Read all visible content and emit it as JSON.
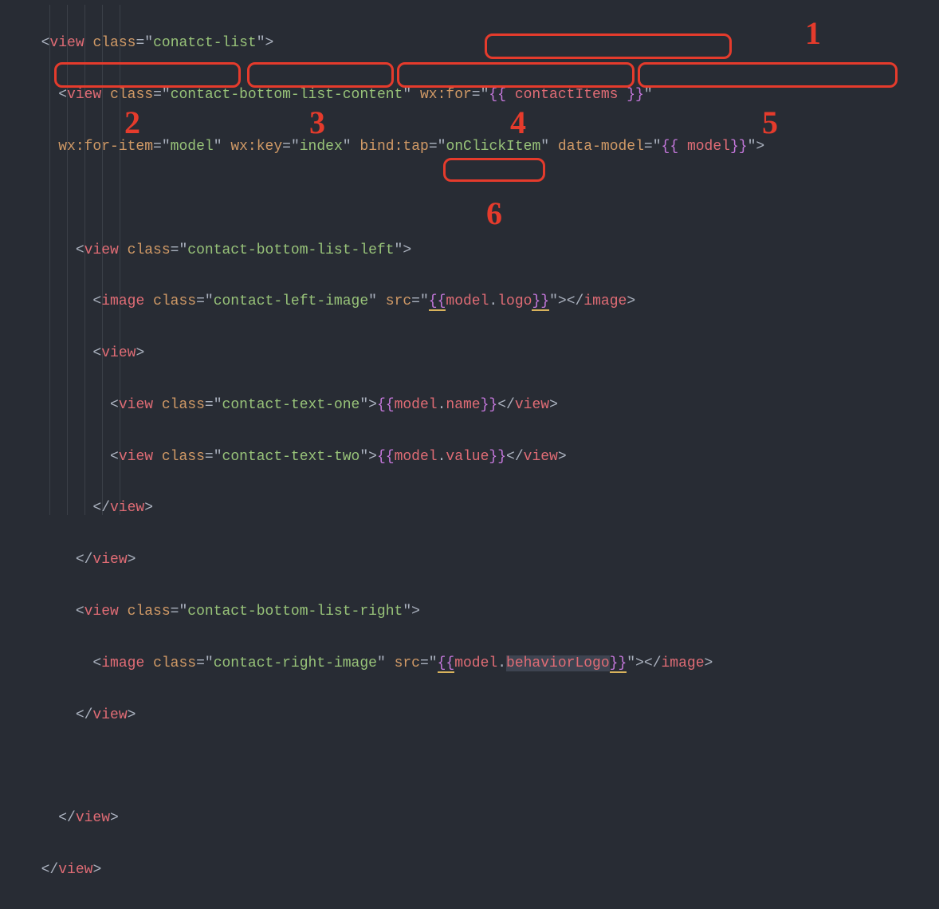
{
  "annotations": {
    "1": "wx:for=\"{{ contactItems }}\"",
    "2": "wx:for-item=\"model\"",
    "3": "wx:key=\"index\"",
    "4": "bind:tap=\"onClickItem\"",
    "5": "data-model=\"{{ model}}\"",
    "6": "model.logo"
  },
  "code": {
    "line1": {
      "tag_open": "<",
      "tag": "view",
      "sp": " ",
      "attr_class": "class",
      "eq": "=",
      "q": "\"",
      "val_class": "conatct-list",
      "close": ">"
    },
    "line2": {
      "indent": "  ",
      "tag_open": "<",
      "tag": "view",
      "sp": " ",
      "attr_class": "class",
      "eq": "=",
      "q": "\"",
      "val_class": "contact-bottom-list-content",
      "attr_wxfor": "wx:for",
      "brace_l": "{{ ",
      "var1": "contactItems",
      "brace_r": " }}"
    },
    "line3": {
      "indent": "  ",
      "attr_foritem": "wx:for-item",
      "val_foritem": "model",
      "attr_wxkey": "wx:key",
      "val_wxkey": "index",
      "attr_bindtap": "bind:tap",
      "val_bindtap": "onClickItem",
      "attr_datamodel": "data-model",
      "brace_l2": "{{ ",
      "var2": "model",
      "brace_r2": "}}",
      "close": ">"
    },
    "line5": {
      "indent": "    ",
      "tag_open": "<",
      "tag": "view",
      "attr_class": "class",
      "val_class": "contact-bottom-list-left",
      "close": ">"
    },
    "line6": {
      "indent": "      ",
      "tag_open": "<",
      "tag": "image",
      "attr_class": "class",
      "val_class": "contact-left-image",
      "attr_src": "src",
      "brace_l": "{{",
      "var": "model",
      "dot": ".",
      "prop": "logo",
      "brace_r": "}}",
      "close": ">",
      "end_open": "</",
      "end_tag": "image",
      "end_close": ">"
    },
    "line7": {
      "indent": "      ",
      "tag_open": "<",
      "tag": "view",
      "close": ">"
    },
    "line8": {
      "indent": "        ",
      "tag_open": "<",
      "tag": "view",
      "attr_class": "class",
      "val_class": "contact-text-one",
      "close": ">",
      "brace_l": "{{",
      "var": "model",
      "dot": ".",
      "prop": "name",
      "brace_r": "}}",
      "end_open": "</",
      "end_tag": "view",
      "end_close": ">"
    },
    "line9": {
      "indent": "        ",
      "tag_open": "<",
      "tag": "view",
      "attr_class": "class",
      "val_class": "contact-text-two",
      "close": ">",
      "brace_l": "{{",
      "var": "model",
      "dot": ".",
      "prop": "value",
      "brace_r": "}}",
      "end_open": "</",
      "end_tag": "view",
      "end_close": ">"
    },
    "line10": {
      "indent": "      ",
      "end_open": "</",
      "end_tag": "view",
      "end_close": ">"
    },
    "line11": {
      "indent": "    ",
      "end_open": "</",
      "end_tag": "view",
      "end_close": ">"
    },
    "line12": {
      "indent": "    ",
      "tag_open": "<",
      "tag": "view",
      "attr_class": "class",
      "val_class": "contact-bottom-list-right",
      "close": ">"
    },
    "line13": {
      "indent": "      ",
      "tag_open": "<",
      "tag": "image",
      "attr_class": "class",
      "val_class": "contact-right-image",
      "attr_src": "src",
      "brace_l": "{{",
      "var": "model",
      "dot": ".",
      "prop": "behaviorLogo",
      "brace_r": "}}",
      "close": ">",
      "end_open": "</",
      "end_tag": "image",
      "end_close": ">"
    },
    "line14": {
      "indent": "    ",
      "end_open": "</",
      "end_tag": "view",
      "end_close": ">"
    },
    "line16": {
      "indent": "  ",
      "end_open": "</",
      "end_tag": "view",
      "end_close": ">"
    },
    "line17": {
      "end_open": "</",
      "end_tag": "view",
      "end_close": ">"
    }
  }
}
